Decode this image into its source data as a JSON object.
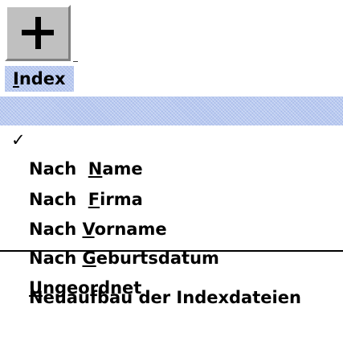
{
  "toolbar": {
    "add_button_icon": "plus-icon"
  },
  "menubar": {
    "title_pre": "",
    "title_mnemonic": "I",
    "title_post": "ndex"
  },
  "menu": {
    "items": [
      {
        "check": "✓",
        "pre": "Nach  ",
        "mnemonic": "N",
        "post": "ame",
        "selected": true
      },
      {
        "check": "",
        "pre": "Nach  ",
        "mnemonic": "F",
        "post": "irma",
        "selected": false
      },
      {
        "check": "",
        "pre": "Nach ",
        "mnemonic": "V",
        "post": "orname",
        "selected": false
      },
      {
        "check": "",
        "pre": "Nach ",
        "mnemonic": "G",
        "post": "eburtsdatum",
        "selected": false
      },
      {
        "check": "",
        "pre": "",
        "mnemonic": "U",
        "post": "ngeordnet",
        "selected": false
      }
    ],
    "rebuild_label": "Neuaufbau der Indexdateien"
  },
  "colors": {
    "highlight": "#b8c9f0",
    "button_face": "#c0c0c0"
  }
}
